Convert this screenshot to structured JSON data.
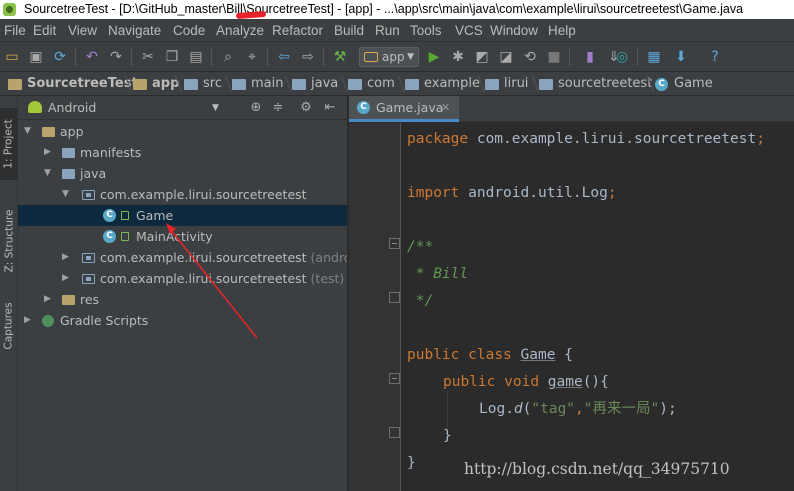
{
  "window": {
    "title": "SourcetreeTest - [D:\\GitHub_master\\Bill\\SourcetreeTest] - [app] - ...\\app\\src\\main\\java\\com\\example\\lirui\\sourcetreetest\\Game.java"
  },
  "menu": [
    "File",
    "Edit",
    "View",
    "Navigate",
    "Code",
    "Analyze",
    "Refactor",
    "Build",
    "Run",
    "Tools",
    "VCS",
    "Window",
    "Help"
  ],
  "toolbar": {
    "run_config": "app",
    "icons": [
      "open-icon",
      "save-icon",
      "sync-icon",
      "undo-icon",
      "redo-icon",
      "cut-icon",
      "copy-icon",
      "paste-icon",
      "find-icon",
      "replace-icon",
      "back-icon",
      "forward-icon",
      "make-icon",
      "run-icon",
      "debug-icon",
      "attach-icon",
      "coverage-icon",
      "stop-icon",
      "avd-icon",
      "sdk-icon",
      "android-monitor-icon",
      "project-structure-icon",
      "gradle-sync-icon",
      "help-icon"
    ]
  },
  "breadcrumb": [
    "SourcetreeTest",
    "app",
    "src",
    "main",
    "java",
    "com",
    "example",
    "lirui",
    "sourcetreetest",
    "Game"
  ],
  "side_tabs": {
    "project": "1: Project",
    "structure": "Z: Structure",
    "captures": "Captures"
  },
  "project_panel": {
    "view_mode": "Android",
    "tree": [
      {
        "label": "app",
        "hint": ""
      },
      {
        "label": "manifests",
        "hint": ""
      },
      {
        "label": "java",
        "hint": ""
      },
      {
        "label": "com.example.lirui.sourcetreetest",
        "hint": ""
      },
      {
        "label": "Game",
        "hint": ""
      },
      {
        "label": "MainActivity",
        "hint": ""
      },
      {
        "label": "com.example.lirui.sourcetreetest",
        "hint": "(androidTest)"
      },
      {
        "label": "com.example.lirui.sourcetreetest",
        "hint": "(test)"
      },
      {
        "label": "res",
        "hint": ""
      },
      {
        "label": "Gradle Scripts",
        "hint": ""
      }
    ]
  },
  "editor": {
    "tab": "Game.java",
    "code": {
      "pkg_kw": "package",
      "pkg_name": "com.example.lirui.sourcetreetest",
      "semi": ";",
      "import_kw": "import",
      "import_name": "android.util.Log",
      "doc_open": "/**",
      "doc_author": " * Bill",
      "doc_close": " */",
      "public1": "public",
      "class_kw": "class",
      "class_name": "Game",
      "brace_open": "{",
      "public2": "public",
      "void_kw": "void",
      "method_name": "game",
      "method_tail": "(){",
      "log_obj": "Log.",
      "log_fn": "d",
      "paren_open": "(",
      "arg1": "\"tag\"",
      "comma": ",",
      "arg2": "\"再来一局\"",
      "paren_close": ");",
      "inner_close": "}",
      "outer_close": "}"
    }
  },
  "watermark": "http://blog.csdn.net/qq_34975710",
  "colors": {
    "keyword": "#cc7832",
    "string": "#6a8759",
    "doc_comment": "#629755",
    "selection": "#0d293e",
    "annotation_arrow": "#e6232a"
  }
}
